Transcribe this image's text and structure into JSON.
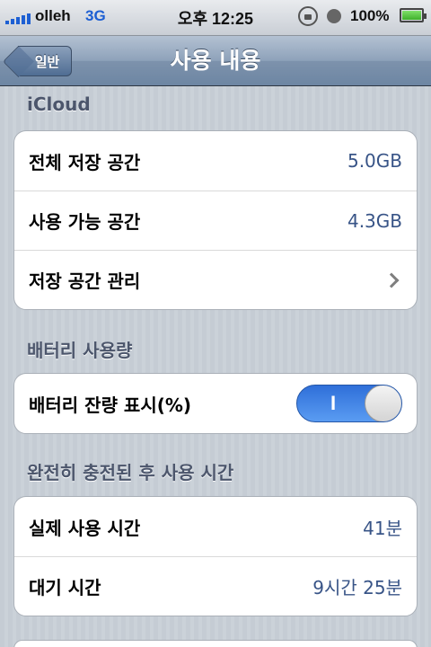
{
  "status_bar": {
    "carrier": "olleh",
    "network": "3G",
    "time": "오후 12:25",
    "battery_percent": "100%",
    "battery_level": 1.0
  },
  "nav": {
    "back_label": "일반",
    "title": "사용 내용"
  },
  "sections": {
    "icloud": {
      "header": "iCloud",
      "rows": [
        {
          "label": "전체 저장 공간",
          "value": "5.0GB"
        },
        {
          "label": "사용 가능 공간",
          "value": "4.3GB"
        },
        {
          "label": "저장 공간 관리"
        }
      ]
    },
    "battery": {
      "header": "배터리 사용량",
      "rows": [
        {
          "label": "배터리 잔량 표시(%)",
          "toggle_text": "I",
          "toggle_on": true
        }
      ]
    },
    "usage": {
      "header": "완전히 충전된 후 사용 시간",
      "rows": [
        {
          "label": "실제 사용 시간",
          "value": "41분"
        },
        {
          "label": "대기 시간",
          "value": "9시간 25분"
        }
      ]
    }
  },
  "colors": {
    "accent_blue": "#385487",
    "toggle_on": "#2f6fd9",
    "nav_bar": "#6d86a3"
  }
}
